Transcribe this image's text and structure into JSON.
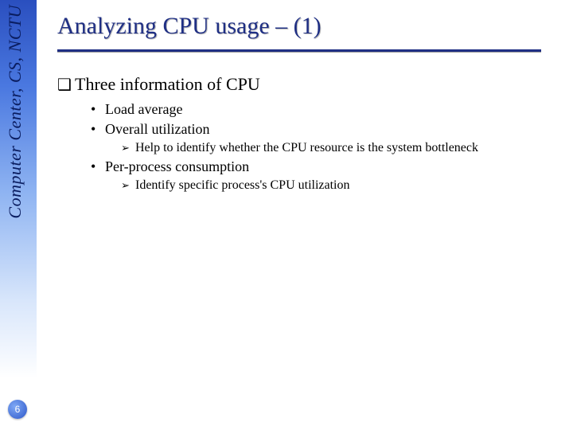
{
  "sidebar": {
    "org_text": "Computer Center, CS, NCTU"
  },
  "page": {
    "number": "6"
  },
  "title": "Analyzing CPU usage – (1)",
  "body": {
    "h1": "Three information of CPU",
    "b1": "Load average",
    "b2": "Overall utilization",
    "b2_sub": "Help to identify whether the CPU resource is the system bottleneck",
    "b3": "Per-process consumption",
    "b3_sub": "Identify specific process's CPU utilization"
  }
}
